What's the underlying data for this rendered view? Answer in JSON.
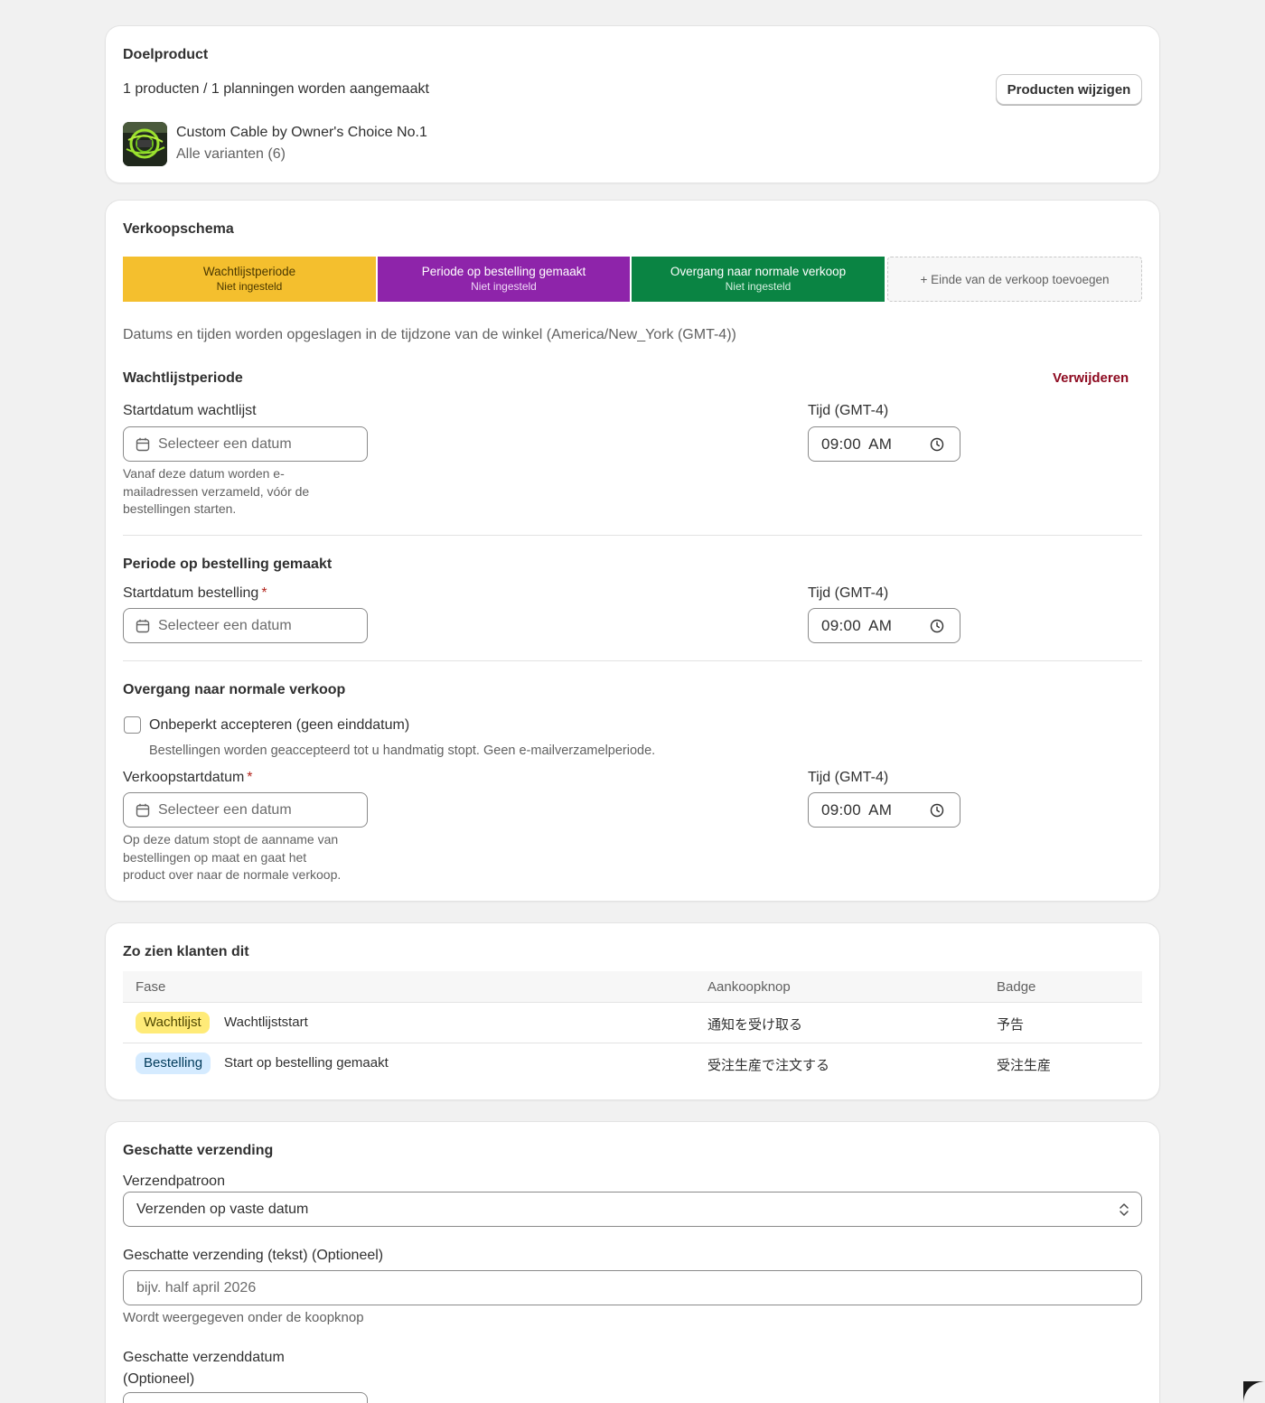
{
  "target_product": {
    "title": "Doelproduct",
    "summary": "1 producten / 1 planningen worden aangemaakt",
    "change_button": "Producten wijzigen",
    "product_name": "Custom Cable by Owner's Choice No.1",
    "variants": "Alle varianten (6)",
    "thumbnail_icon": "product-thumbnail"
  },
  "sales_schedule": {
    "title": "Verkoopschema",
    "segments": [
      {
        "title": "Wachtlijstperiode",
        "status": "Niet ingesteld",
        "color": "#f4bf2e"
      },
      {
        "title": "Periode op bestelling gemaakt",
        "status": "Niet ingesteld",
        "color": "#8e24aa"
      },
      {
        "title": "Overgang naar normale verkoop",
        "status": "Niet ingesteld",
        "color": "#0a8443"
      }
    ],
    "add_end_label": "+ Einde van de verkoop toevoegen",
    "timezone_note": "Datums en tijden worden opgeslagen in de tijdzone van de winkel (America/New_York (GMT-4))",
    "waitlist": {
      "heading": "Wachtlijstperiode",
      "remove": "Verwijderen",
      "date_label": "Startdatum wachtlijst",
      "date_placeholder": "Selecteer een datum",
      "time_label": "Tijd (GMT-4)",
      "time_value": "09:00 AM",
      "help_line1": "Vanaf deze datum worden e-",
      "help_line2": "mailadressen verzameld, vóór de",
      "help_line3": "bestellingen starten."
    },
    "made_to_order": {
      "heading": "Periode op bestelling gemaakt",
      "date_label": "Startdatum bestelling",
      "required_mark": "*",
      "date_placeholder": "Selecteer een datum",
      "time_label": "Tijd (GMT-4)",
      "time_value": "09:00 AM"
    },
    "transition": {
      "heading": "Overgang naar normale verkoop",
      "checkbox_label": "Onbeperkt accepteren (geen einddatum)",
      "checkbox_checked": false,
      "checkbox_help": "Bestellingen worden geaccepteerd tot u handmatig stopt. Geen e-mailverzamelperiode.",
      "date_label": "Verkoopstartdatum",
      "required_mark": "*",
      "date_placeholder": "Selecteer een datum",
      "time_label": "Tijd (GMT-4)",
      "time_value": "09:00 AM",
      "help_line1": "Op deze datum stopt de aanname van",
      "help_line2": "bestellingen op maat en gaat het",
      "help_line3": "product over naar de normale verkoop."
    }
  },
  "customer_view": {
    "title": "Zo zien klanten dit",
    "columns": [
      "Fase",
      "Aankoopknop",
      "Badge"
    ],
    "rows": [
      {
        "badge": "Wachtlijst",
        "badge_color": "#ffeb78",
        "phase": "Wachtlijststart",
        "button": "通知を受け取る",
        "label": "予告"
      },
      {
        "badge": "Bestelling",
        "badge_color": "#d5ebff",
        "phase": "Start op bestelling gemaakt",
        "button": "受注生産で注文する",
        "label": "受注生産"
      }
    ]
  },
  "shipping": {
    "title": "Geschatte verzending",
    "pattern_label": "Verzendpatroon",
    "pattern_value": "Verzenden op vaste datum",
    "text_label": "Geschatte verzending (tekst) (Optioneel)",
    "text_placeholder": "bijv. half april 2026",
    "text_help": "Wordt weergegeven onder de koopknop",
    "date_label_line1": "Geschatte verzenddatum",
    "date_label_line2": "(Optioneel)"
  }
}
